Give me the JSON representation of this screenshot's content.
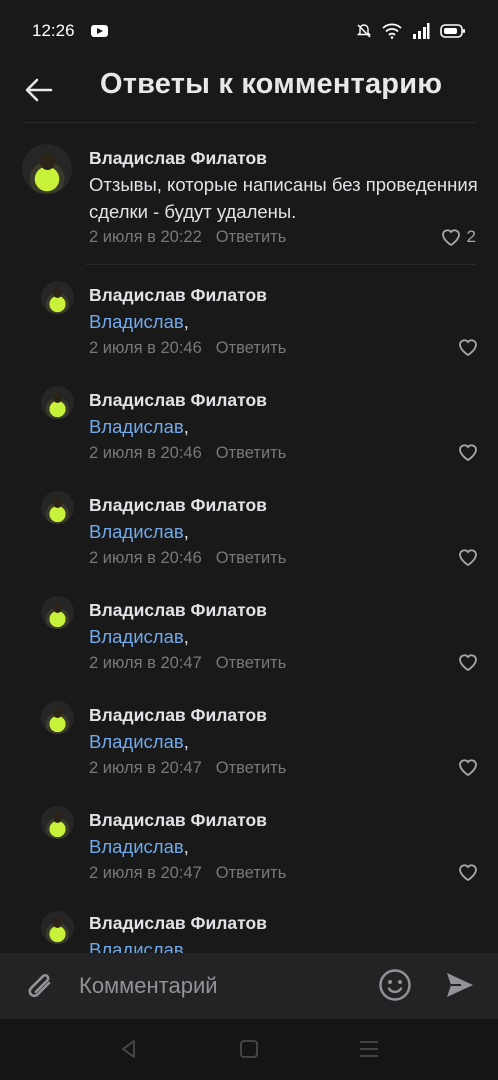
{
  "status": {
    "time": "12:26"
  },
  "header": {
    "title": "Ответы к комментарию"
  },
  "main": {
    "name": "Владислав Филатов",
    "text": "Отзывы, которые написаны без проведенния сделки - будут удалены.",
    "date": "2 июля в 20:22",
    "reply": "Ответить",
    "likes": "2"
  },
  "replies": [
    {
      "name": "Владислав Филатов",
      "mention": "Владислав",
      "suffix": ",",
      "date": "2 июля в 20:46",
      "reply": "Ответить"
    },
    {
      "name": "Владислав Филатов",
      "mention": "Владислав",
      "suffix": ",",
      "date": "2 июля в 20:46",
      "reply": "Ответить"
    },
    {
      "name": "Владислав Филатов",
      "mention": "Владислав",
      "suffix": ",",
      "date": "2 июля в 20:46",
      "reply": "Ответить"
    },
    {
      "name": "Владислав Филатов",
      "mention": "Владислав",
      "suffix": ",",
      "date": "2 июля в 20:47",
      "reply": "Ответить"
    },
    {
      "name": "Владислав Филатов",
      "mention": "Владислав",
      "suffix": ",",
      "date": "2 июля в 20:47",
      "reply": "Ответить"
    },
    {
      "name": "Владислав Филатов",
      "mention": "Владислав",
      "suffix": ",",
      "date": "2 июля в 20:47",
      "reply": "Ответить"
    },
    {
      "name": "Владислав Филатов",
      "mention": "Владислав",
      "suffix": ",",
      "date": "",
      "reply": ""
    }
  ],
  "compose": {
    "placeholder": "Комментарий"
  },
  "colors": {
    "background": "#19191a",
    "mention": "#71aaeb",
    "meta": "#76787a"
  },
  "icons": [
    "back-arrow-icon",
    "like-heart-icon",
    "attach-icon",
    "emoji-icon",
    "send-icon"
  ]
}
